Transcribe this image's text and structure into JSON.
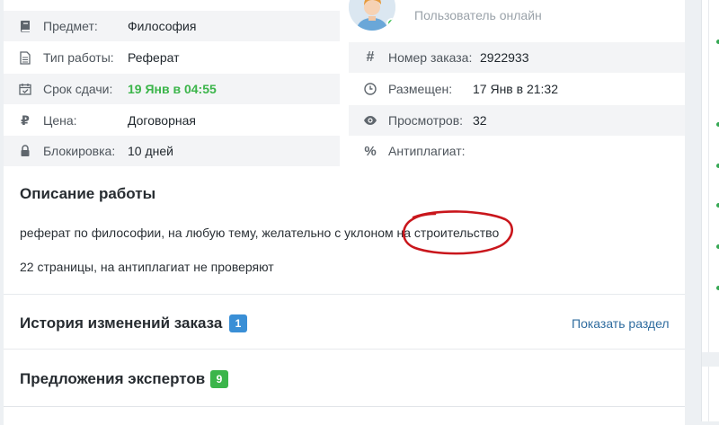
{
  "order": {
    "left": {
      "subject": {
        "label": "Предмет:",
        "value": "Философия"
      },
      "work_type": {
        "label": "Тип работы:",
        "value": "Реферат"
      },
      "deadline": {
        "label": "Срок сдачи:",
        "value": "19 Янв в 04:55"
      },
      "price": {
        "label": "Цена:",
        "value": "Договорная"
      },
      "lock": {
        "label": "Блокировка:",
        "value": "10 дней"
      }
    },
    "right": {
      "user_status": "Пользователь онлайн",
      "order_number": {
        "label": "Номер заказа:",
        "value": "2922933"
      },
      "posted": {
        "label": "Размещен:",
        "value": "17 Янв в 21:32"
      },
      "views": {
        "label": "Просмотров:",
        "value": "32"
      },
      "antiplagiat": {
        "label": "Антиплагиат:",
        "value": ""
      }
    }
  },
  "description": {
    "title": "Описание работы",
    "line1_before": "реферат по философии, на любую тему, желательно с уклоном на ",
    "line1_highlight": "строительство",
    "line2": "22 страницы, на антиплагиат не проверяют"
  },
  "history": {
    "title": "История изменений заказа",
    "count": "1",
    "show_link": "Показать раздел"
  },
  "offers": {
    "title": "Предложения экспертов",
    "count": "9"
  },
  "colors": {
    "deadline": "#3bb54a",
    "history_badge": "#3a8fd6",
    "offers_badge": "#3bb54a",
    "highlight_circle": "#c9161c",
    "link": "#2f6c9f"
  },
  "icons": [
    "book-icon",
    "file-icon",
    "calendar-check-icon",
    "ruble-icon",
    "lock-icon",
    "hash-icon",
    "clock-icon",
    "eye-icon",
    "percent-icon"
  ]
}
